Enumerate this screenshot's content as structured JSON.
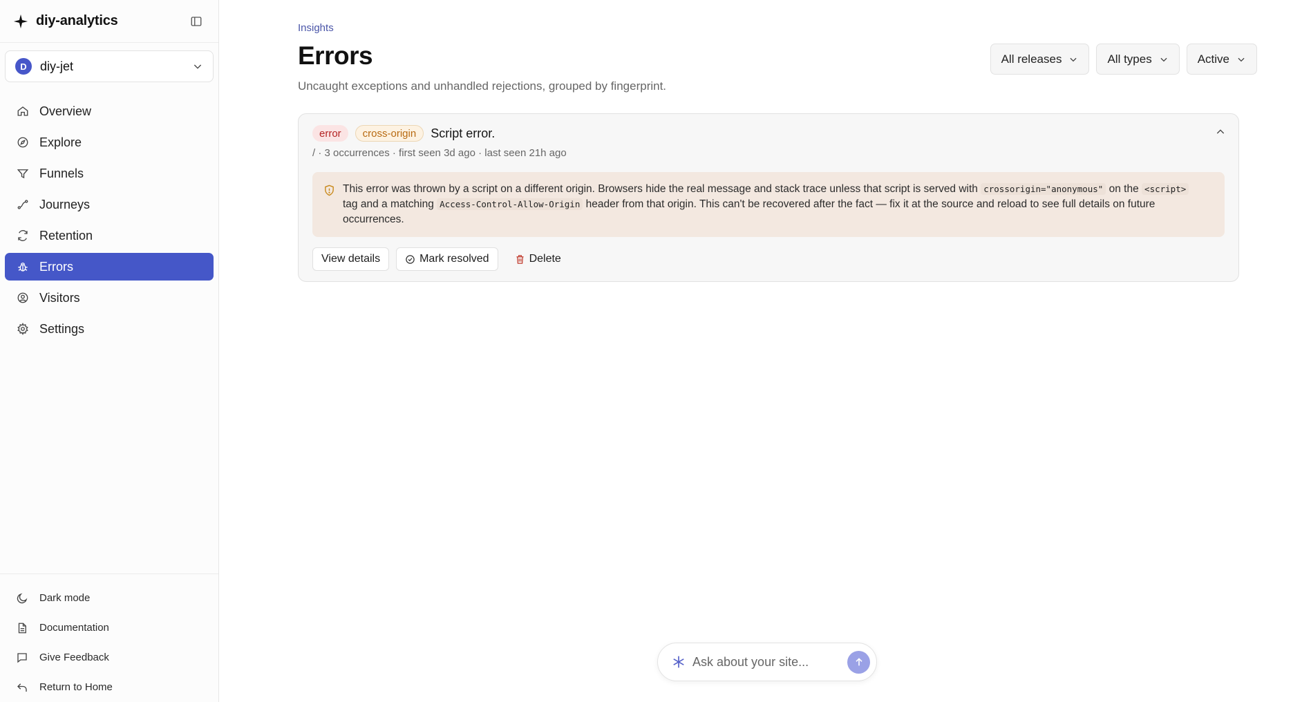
{
  "brand": {
    "name": "diy-analytics",
    "icon": "sparkle-icon"
  },
  "site": {
    "avatar_letter": "D",
    "name": "diy-jet"
  },
  "nav": [
    {
      "label": "Overview",
      "icon": "home-icon"
    },
    {
      "label": "Explore",
      "icon": "compass-icon"
    },
    {
      "label": "Funnels",
      "icon": "funnel-icon"
    },
    {
      "label": "Journeys",
      "icon": "route-icon"
    },
    {
      "label": "Retention",
      "icon": "refresh-icon"
    },
    {
      "label": "Errors",
      "icon": "bug-icon",
      "active": true
    },
    {
      "label": "Visitors",
      "icon": "user-circle-icon"
    },
    {
      "label": "Settings",
      "icon": "gear-icon"
    }
  ],
  "footer": [
    {
      "label": "Dark mode",
      "icon": "moon-icon"
    },
    {
      "label": "Documentation",
      "icon": "document-icon"
    },
    {
      "label": "Give Feedback",
      "icon": "message-icon"
    },
    {
      "label": "Return to Home",
      "icon": "return-icon"
    }
  ],
  "header": {
    "breadcrumb": "Insights",
    "title": "Errors",
    "subtitle": "Uncaught exceptions and unhandled rejections, grouped by fingerprint."
  },
  "filters": {
    "releases": "All releases",
    "types": "All types",
    "status": "Active"
  },
  "error_card": {
    "badge_level": "error",
    "badge_kind": "cross-origin",
    "title": "Script error.",
    "meta": "/ · 3 occurrences · first seen 3d ago · last seen 21h ago",
    "warning": {
      "text_1": "This error was thrown by a script on a different origin. Browsers hide the real message and stack trace unless that script is served with ",
      "code_1": "crossorigin=\"anonymous\"",
      "text_2": " on the ",
      "code_2": "<script>",
      "text_3": " tag and a matching ",
      "code_3": "Access-Control-Allow-Origin",
      "text_4": " header from that origin. This can't be recovered after the fact — fix it at the source and reload to see full details on future occurrences."
    },
    "actions": {
      "view": "View details",
      "resolve": "Mark resolved",
      "delete": "Delete"
    }
  },
  "ask": {
    "placeholder": "Ask about your site..."
  },
  "colors": {
    "accent": "#4557c8",
    "error_badge_bg": "#fbe4e4",
    "error_badge_text": "#b42424",
    "warning_bg": "#f3e8e0",
    "delete_icon": "#c0392b"
  }
}
